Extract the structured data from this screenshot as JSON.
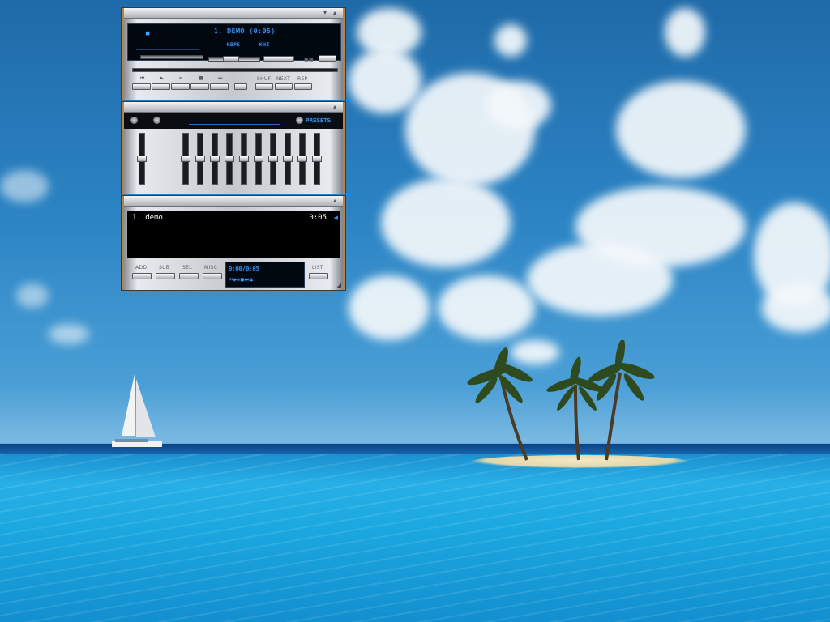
{
  "player": {
    "track_title": "1. DEMO (0:05)",
    "kbps": "KBPS",
    "khz": "KHZ",
    "shuf_label": "SHUF",
    "next_label": "NEXT",
    "rep_label": "REP"
  },
  "equalizer": {
    "presets_label": "PRESETS",
    "preamp_level": 0.5,
    "band_levels": [
      0.5,
      0.5,
      0.5,
      0.5,
      0.5,
      0.5,
      0.5,
      0.5,
      0.5,
      0.5
    ]
  },
  "playlist": {
    "items": [
      {
        "title": "1. demo",
        "duration": "0:05"
      }
    ],
    "add_label": "ADD",
    "sub_label": "SUB",
    "sel_label": "SEL",
    "misc_label": "MISC",
    "time_display": "0:00/0:05",
    "list_label": "LIST"
  },
  "colors": {
    "lcd_text": "#4aa3ff",
    "frame_accent": "#c2803f"
  }
}
